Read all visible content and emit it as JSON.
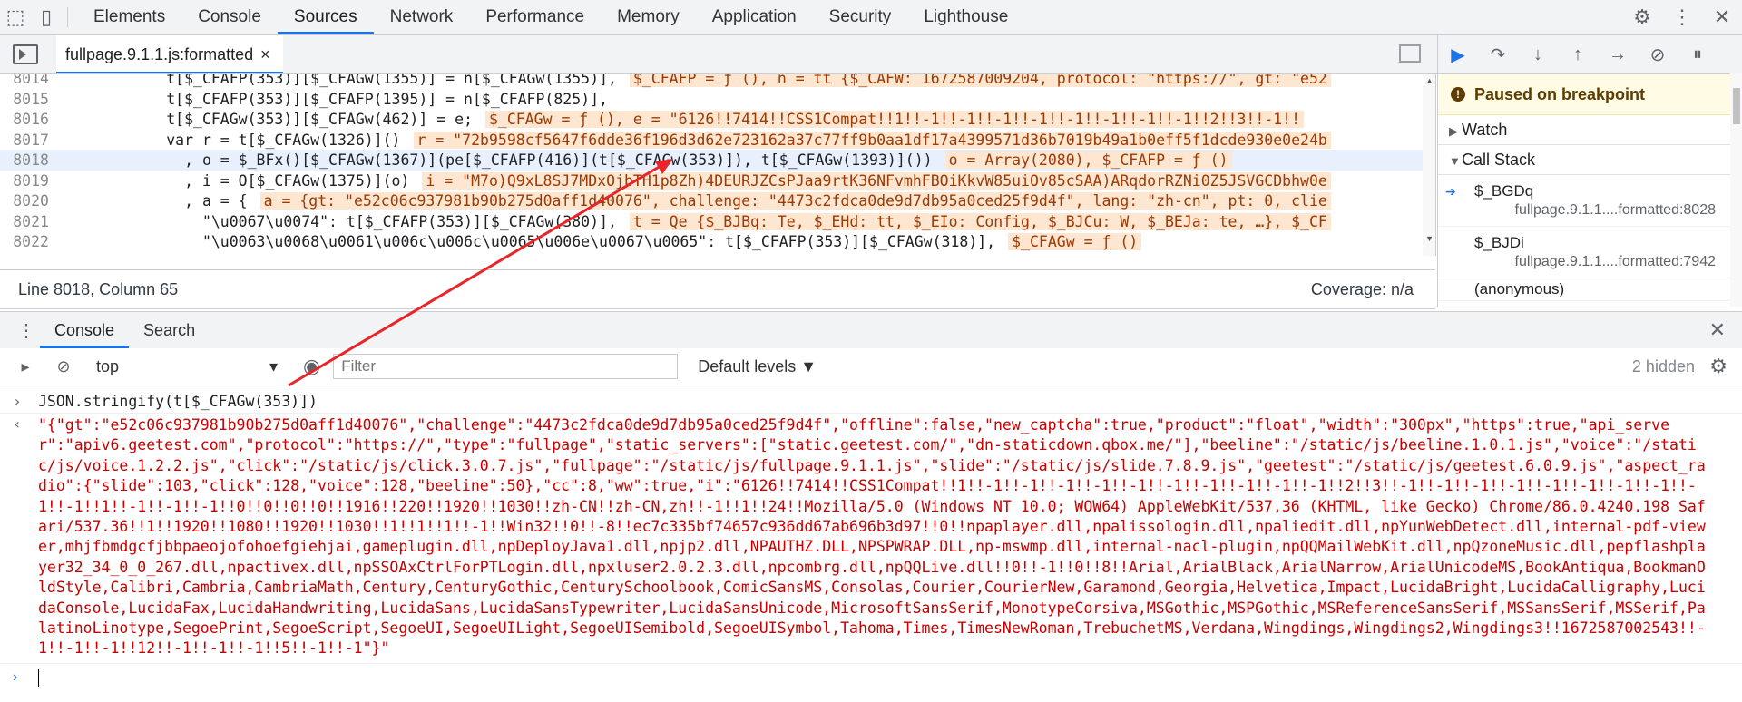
{
  "toolbar": {
    "tabs": [
      "Elements",
      "Console",
      "Sources",
      "Network",
      "Performance",
      "Memory",
      "Application",
      "Security",
      "Lighthouse"
    ],
    "active_tab": "Sources"
  },
  "file_tab": {
    "name": "fullpage.9.1.1.js:formatted",
    "close": "×"
  },
  "code_lines": [
    {
      "n": "8014",
      "src": "            t[$_CFAFP(353)][$_CFAGw(1355)] = n[$_CFAGw(1355)],",
      "eval": "$_CFAFP = ƒ (), n = tt {$_CAFW: 1672587009204, protocol: \"https://\", gt: \"e52"
    },
    {
      "n": "8015",
      "src": "            t[$_CFAFP(353)][$_CFAFP(1395)] = n[$_CFAFP(825)],",
      "eval": ""
    },
    {
      "n": "8016",
      "src": "            t[$_CFAGw(353)][$_CFAGw(462)] = e;",
      "eval": "$_CFAGw = ƒ (), e = \"6126!!7414!!CSS1Compat!!1!!-1!!-1!!-1!!-1!!-1!!-1!!-1!!-1!!2!!3!!-1!!"
    },
    {
      "n": "8017",
      "src": "            var r = t[$_CFAGw(1326)]()",
      "eval": "r = \"72b9598cf5647f6dde36f196d3d62e723162a37c77ff9b0aa1df17a4399571d36b7019b49a1b0eff5f1dcde930e0e24b"
    },
    {
      "n": "8018",
      "src": "              , o = $_BFx()[$_CFAGw(1367)](pe[$_CFAFP(416)](t[$_CFAGw(353)]), t[$_CFAGw(1393)]())",
      "eval": "o = Array(2080), $_CFAFP = ƒ ()"
    },
    {
      "n": "8019",
      "src": "              , i = O[$_CFAGw(1375)](o)",
      "eval": "i = \"M7o)Q9xL8SJ7MDxOjbTH1p8Zh)4DEURJZCsPJaa9rtK36NFvmhFBOiKkvW85uiOv85cSAA)ARqdorRZNi0Z5JSVGCDbhw0e"
    },
    {
      "n": "8020",
      "src": "              , a = {",
      "eval": "a = {gt: \"e52c06c937981b90b275d0aff1d40076\", challenge: \"4473c2fdca0de9d7db95a0ced25f9d4f\", lang: \"zh-cn\", pt: 0, clie"
    },
    {
      "n": "8021",
      "src": "                \"\\u0067\\u0074\": t[$_CFAFP(353)][$_CFAGw(380)],",
      "eval": "t = Qe {$_BJBq: Te, $_EHd: tt, $_EIo: Config, $_BJCu: W, $_BEJa: te, …}, $_CF"
    },
    {
      "n": "8022",
      "src": "                \"\\u0063\\u0068\\u0061\\u006c\\u006c\\u0065\\u006e\\u0067\\u0065\": t[$_CFAFP(353)][$_CFAGw(318)],",
      "eval": "$_CFAGw = ƒ ()"
    },
    {
      "n": "8023",
      "src": "",
      "eval": ""
    }
  ],
  "status": {
    "position": "Line 8018, Column 65",
    "coverage": "Coverage: n/a"
  },
  "debugger": {
    "paused": "Paused on breakpoint",
    "watch": "Watch",
    "call_stack": "Call Stack",
    "frames": [
      {
        "fn": "$_BGDq",
        "loc": "fullpage.9.1.1....formatted:8028"
      },
      {
        "fn": "$_BJDi",
        "loc": "fullpage.9.1.1....formatted:7942"
      },
      {
        "fn": "(anonymous)",
        "loc": ""
      }
    ]
  },
  "drawer": {
    "tabs": [
      "Console",
      "Search"
    ],
    "active": "Console"
  },
  "console_toolbar": {
    "context": "top",
    "filter_placeholder": "Filter",
    "levels": "Default levels ▼",
    "hidden": "2 hidden"
  },
  "console": {
    "command": "JSON.stringify(t[$_CFAGw(353)])",
    "result": "\"{\"gt\":\"e52c06c937981b90b275d0aff1d40076\",\"challenge\":\"4473c2fdca0de9d7db95a0ced25f9d4f\",\"offline\":false,\"new_captcha\":true,\"product\":\"float\",\"width\":\"300px\",\"https\":true,\"api_server\":\"apiv6.geetest.com\",\"protocol\":\"https://\",\"type\":\"fullpage\",\"static_servers\":[\"static.geetest.com/\",\"dn-staticdown.qbox.me/\"],\"beeline\":\"/static/js/beeline.1.0.1.js\",\"voice\":\"/static/js/voice.1.2.2.js\",\"click\":\"/static/js/click.3.0.7.js\",\"fullpage\":\"/static/js/fullpage.9.1.1.js\",\"slide\":\"/static/js/slide.7.8.9.js\",\"geetest\":\"/static/js/geetest.6.0.9.js\",\"aspect_radio\":{\"slide\":103,\"click\":128,\"voice\":128,\"beeline\":50},\"cc\":8,\"ww\":true,\"i\":\"6126!!7414!!CSS1Compat!!1!!-1!!-1!!-1!!-1!!-1!!-1!!-1!!-1!!-1!!-1!!2!!3!!-1!!-1!!-1!!-1!!-1!!-1!!-1!!-1!!-1!!-1!!1!!-1!!-1!!-1!!0!!0!!0!!0!!1916!!220!!1920!!1030!!zh-CN!!zh-CN,zh!!-1!!1!!24!!Mozilla/5.0 (Windows NT 10.0; WOW64) AppleWebKit/537.36 (KHTML, like Gecko) Chrome/86.0.4240.198 Safari/537.36!!1!!1920!!1080!!1920!!1030!!1!!1!!1!!-1!!Win32!!0!!-8!!ec7c335bf74657c936dd67ab696b3d97!!0!!npaplayer.dll,npalissologin.dll,npaliedit.dll,npYunWebDetect.dll,internal-pdf-viewer,mhjfbmdgcfjbbpaeojofohoefgiehjai,gameplugin.dll,npDeployJava1.dll,npjp2.dll,NPAUTHZ.DLL,NPSPWRAP.DLL,np-mswmp.dll,internal-nacl-plugin,npQQMailWebKit.dll,npQzoneMusic.dll,pepflashplayer32_34_0_0_267.dll,npactivex.dll,npSSOAxCtrlForPTLogin.dll,npxluser2.0.2.3.dll,npcombrg.dll,npQQLive.dll!!0!!-1!!0!!8!!Arial,ArialBlack,ArialNarrow,ArialUnicodeMS,BookAntiqua,BookmanOldStyle,Calibri,Cambria,CambriaMath,Century,CenturyGothic,CenturySchoolbook,ComicSansMS,Consolas,Courier,CourierNew,Garamond,Georgia,Helvetica,Impact,LucidaBright,LucidaCalligraphy,LucidaConsole,LucidaFax,LucidaHandwriting,LucidaSans,LucidaSansTypewriter,LucidaSansUnicode,MicrosoftSansSerif,MonotypeCorsiva,MSGothic,MSPGothic,MSReferenceSansSerif,MSSansSerif,MSSerif,PalatinoLinotype,SegoePrint,SegoeScript,SegoeUI,SegoeUILight,SegoeUISemibold,SegoeUISymbol,Tahoma,Times,TimesNewRoman,TrebuchetMS,Verdana,Wingdings,Wingdings2,Wingdings3!!1672587002543!!-1!!-1!!-1!!12!!-1!!-1!!-1!!5!!-1!!-1\"}\""
  },
  "colors": {
    "accent": "#1a73e8",
    "annotation_arrow": "#e8262a",
    "error_text": "#c80000"
  }
}
